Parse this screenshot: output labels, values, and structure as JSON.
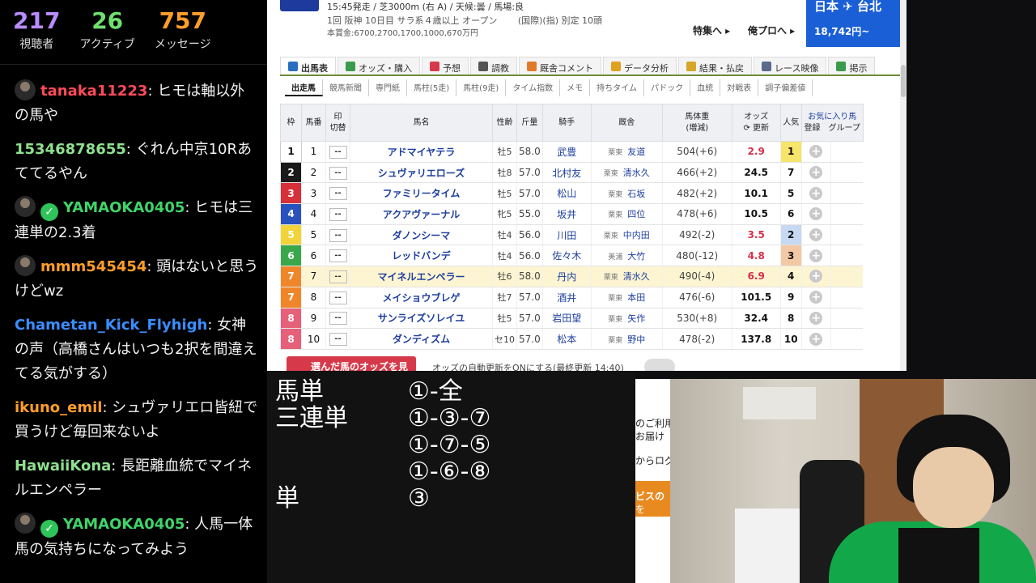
{
  "stats": [
    {
      "num": "217",
      "label": "視聴者",
      "color": "#b98cff"
    },
    {
      "num": "26",
      "label": "アクティブ",
      "color": "#6ee06e"
    },
    {
      "num": "757",
      "label": "メッセージ",
      "color": "#ff9e2a"
    }
  ],
  "chat": [
    {
      "user": "tanaka11223",
      "text": "ヒモは軸以外の馬や",
      "color": "#ff4a5a",
      "avatar": true,
      "badge": false
    },
    {
      "user": "15346878655",
      "text": "ぐれん中京10Rあててるやん",
      "color": "#8fe08f",
      "avatar": false,
      "badge": false
    },
    {
      "user": "YAMAOKA0405",
      "text": "ヒモは三連単の2.3着",
      "color": "#3fd46a",
      "avatar": true,
      "badge": true
    },
    {
      "user": "mmm545454",
      "text": "頭はないと思うけどwz",
      "color": "#ff9e2a",
      "avatar": true,
      "badge": false
    },
    {
      "user": "Chametan_Kick_Flyhigh",
      "text": "女神の声（高橋さんはいつも2択を間違えてる気がする）",
      "color": "#3a8dff",
      "avatar": false,
      "badge": false
    },
    {
      "user": "ikuno_emil",
      "text": "シュヴァリエロ皆紐で買うけど毎回来ないよ",
      "color": "#ff9e2a",
      "avatar": false,
      "badge": false
    },
    {
      "user": "HawaiiKona",
      "text": "長距離血統でマイネルエンペラー",
      "color": "#8fe08f",
      "avatar": false,
      "badge": false
    },
    {
      "user": "YAMAOKA0405",
      "text": "人馬一体　馬の気持ちになってみよう",
      "color": "#3fd46a",
      "avatar": true,
      "badge": true
    }
  ],
  "race": {
    "line1": "15:45発走 / 芝3000m (右 A) / 天候:曇 / 馬場:良",
    "line2": "1回 阪神 10日目 サラ系４歳以上 オープン 　　(国際)(指) 別定 10頭",
    "line3": "本賞金:6700,2700,1700,1000,670万円",
    "link1": "特集へ ▸",
    "link2": "俺プロへ ▸",
    "ad_title": "日本 ✈ 台北",
    "ad_price": "18,742円~"
  },
  "tabs": [
    {
      "label": "出馬表",
      "active": true,
      "icon": "#2a6fbf"
    },
    {
      "label": "オッズ・購入",
      "active": false,
      "icon": "#3c9a4c"
    },
    {
      "label": "予想",
      "active": false,
      "icon": "#d63a4a"
    },
    {
      "label": "調教",
      "active": false,
      "icon": "#555555"
    },
    {
      "label": "厩舎コメント",
      "active": false,
      "icon": "#e07a2a"
    },
    {
      "label": "データ分析",
      "active": false,
      "icon": "#e0a020"
    },
    {
      "label": "結果・払戻",
      "active": false,
      "icon": "#d6a62a"
    },
    {
      "label": "レース映像",
      "active": false,
      "icon": "#5a6a8a"
    },
    {
      "label": "掲示",
      "active": false,
      "icon": "#3c9a4c"
    }
  ],
  "subtabs": [
    "出走馬",
    "競馬新聞",
    "専門紙",
    "馬柱(5走)",
    "馬柱(9走)",
    "タイム指数",
    "メモ",
    "持ちタイム",
    "パドック",
    "血統",
    "対戦表",
    "調子偏差値"
  ],
  "headers": {
    "waku": "枠",
    "umaban": "馬番",
    "mark": "印",
    "mark_sub": "切替",
    "name": "馬名",
    "sexage": "性齢",
    "weight": "斤量",
    "jockey": "騎手",
    "trainer": "厩舎",
    "bw": "馬体重",
    "bw_sub": "(増減)",
    "odds": "オッズ",
    "odds_sub": "更新",
    "ninki": "人気",
    "fav": "お気に入り馬",
    "fav_sub1": "登録",
    "fav_sub2": "グループ"
  },
  "horses": [
    {
      "waku": "1",
      "waku_bg": "#ffffff",
      "waku_fg": "#111111",
      "umaban": "1",
      "mark": "--",
      "name": "アドマイヤテラ",
      "sexage": "牡5",
      "weight": "58.0",
      "jockey": "武豊",
      "stable": "栗東",
      "trainer": "友道",
      "bw": "504(+6)",
      "odds": "2.9",
      "odds_color": "#d6304a",
      "ninki": "1",
      "ninki_bg": "#f7e46a",
      "hl": false
    },
    {
      "waku": "2",
      "waku_bg": "#1a1a1a",
      "waku_fg": "#ffffff",
      "umaban": "2",
      "mark": "--",
      "name": "シュヴァリエローズ",
      "sexage": "牡8",
      "weight": "57.0",
      "jockey": "北村友",
      "stable": "栗東",
      "trainer": "清水久",
      "bw": "466(+2)",
      "odds": "24.5",
      "odds_color": "#111111",
      "ninki": "7",
      "ninki_bg": "",
      "hl": false
    },
    {
      "waku": "3",
      "waku_bg": "#d6303a",
      "waku_fg": "#ffffff",
      "umaban": "3",
      "mark": "--",
      "name": "ファミリータイム",
      "sexage": "牡5",
      "weight": "57.0",
      "jockey": "松山",
      "stable": "栗東",
      "trainer": "石坂",
      "bw": "482(+2)",
      "odds": "10.1",
      "odds_color": "#111111",
      "ninki": "5",
      "ninki_bg": "",
      "hl": false
    },
    {
      "waku": "4",
      "waku_bg": "#2a52be",
      "waku_fg": "#ffffff",
      "umaban": "4",
      "mark": "--",
      "name": "アクアヴァーナル",
      "sexage": "牝5",
      "weight": "55.0",
      "jockey": "坂井",
      "stable": "栗東",
      "trainer": "四位",
      "bw": "478(+6)",
      "odds": "10.5",
      "odds_color": "#111111",
      "ninki": "6",
      "ninki_bg": "",
      "hl": false
    },
    {
      "waku": "5",
      "waku_bg": "#f2d43a",
      "waku_fg": "#ffffff",
      "umaban": "5",
      "mark": "--",
      "name": "ダノンシーマ",
      "sexage": "牡4",
      "weight": "56.0",
      "jockey": "川田",
      "stable": "栗東",
      "trainer": "中内田",
      "bw": "492(-2)",
      "odds": "3.5",
      "odds_color": "#d6304a",
      "ninki": "2",
      "ninki_bg": "#c7d9f2",
      "hl": false
    },
    {
      "waku": "6",
      "waku_bg": "#3aa84a",
      "waku_fg": "#ffffff",
      "umaban": "6",
      "mark": "--",
      "name": "レッドバンデ",
      "sexage": "牡4",
      "weight": "56.0",
      "jockey": "佐々木",
      "stable": "美浦",
      "trainer": "大竹",
      "bw": "480(-12)",
      "odds": "4.8",
      "odds_color": "#d6304a",
      "ninki": "3",
      "ninki_bg": "#f2c9a4",
      "hl": false
    },
    {
      "waku": "7",
      "waku_bg": "#f0862a",
      "waku_fg": "#ffffff",
      "umaban": "7",
      "mark": "--",
      "name": "マイネルエンペラー",
      "sexage": "牡6",
      "weight": "58.0",
      "jockey": "丹内",
      "stable": "栗東",
      "trainer": "清水久",
      "bw": "490(-4)",
      "odds": "6.9",
      "odds_color": "#d6304a",
      "ninki": "4",
      "ninki_bg": "",
      "hl": true
    },
    {
      "waku": "7",
      "waku_bg": "#f0862a",
      "waku_fg": "#ffffff",
      "umaban": "8",
      "mark": "--",
      "name": "メイショウブレゲ",
      "sexage": "牡7",
      "weight": "57.0",
      "jockey": "酒井",
      "stable": "栗東",
      "trainer": "本田",
      "bw": "476(-6)",
      "odds": "101.5",
      "odds_color": "#111111",
      "ninki": "9",
      "ninki_bg": "",
      "hl": false
    },
    {
      "waku": "8",
      "waku_bg": "#e6607a",
      "waku_fg": "#ffffff",
      "umaban": "9",
      "mark": "--",
      "name": "サンライズソレイユ",
      "sexage": "牡5",
      "weight": "57.0",
      "jockey": "岩田望",
      "stable": "栗東",
      "trainer": "矢作",
      "bw": "530(+8)",
      "odds": "32.4",
      "odds_color": "#111111",
      "ninki": "8",
      "ninki_bg": "",
      "hl": false
    },
    {
      "waku": "8",
      "waku_bg": "#e6607a",
      "waku_fg": "#ffffff",
      "umaban": "10",
      "mark": "--",
      "name": "ダンディズム",
      "sexage": "セ10",
      "weight": "57.0",
      "jockey": "松本",
      "stable": "栗東",
      "trainer": "野中",
      "bw": "478(-2)",
      "odds": "137.8",
      "odds_color": "#111111",
      "ninki": "10",
      "ninki_bg": "",
      "hl": false
    }
  ],
  "bottom": {
    "odds_button": "選んだ馬のオッズを見る",
    "auto_update": "オッズの自動更新をONにする(最終更新 14:40)"
  },
  "bets": [
    {
      "type": "馬単",
      "combo": "①-全"
    },
    {
      "type": "三連単",
      "combo": "①-③-⑦"
    },
    {
      "type": "",
      "combo": "①-⑦-⑤"
    },
    {
      "type": "",
      "combo": "①-⑥-⑧"
    },
    {
      "type": "単",
      "combo": "③"
    }
  ],
  "bgpage": [
    "のご利用",
    "お届け",
    "からログ",
    "ビスの",
    "を"
  ]
}
